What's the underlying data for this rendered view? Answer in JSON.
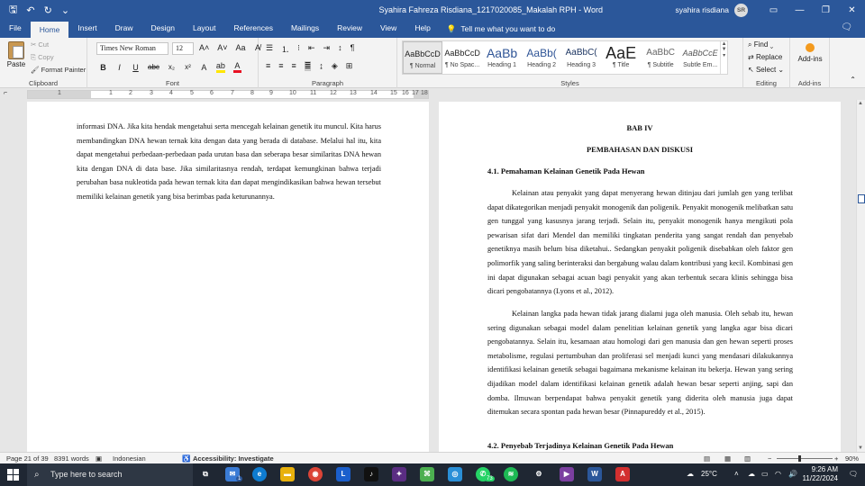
{
  "titlebar": {
    "title": "Syahira Fahreza Risdiana_1217020085_Makalah RPH  -  Word",
    "user_name": "syahira risdiana",
    "user_initials": "SR"
  },
  "tabs": [
    {
      "label": "File"
    },
    {
      "label": "Home"
    },
    {
      "label": "Insert"
    },
    {
      "label": "Draw"
    },
    {
      "label": "Design"
    },
    {
      "label": "Layout"
    },
    {
      "label": "References"
    },
    {
      "label": "Mailings"
    },
    {
      "label": "Review"
    },
    {
      "label": "View"
    },
    {
      "label": "Help"
    }
  ],
  "tellme": "Tell me what you want to do",
  "ribbon": {
    "clipboard": {
      "paste": "Paste",
      "cut": "Cut",
      "copy": "Copy",
      "format_painter": "Format Painter",
      "label": "Clipboard"
    },
    "font": {
      "name": "Times New Roman",
      "size": "12",
      "label": "Font"
    },
    "paragraph": {
      "label": "Paragraph"
    },
    "styles": {
      "label": "Styles",
      "items": [
        {
          "sample": "AaBbCcD",
          "name": "¶ Normal"
        },
        {
          "sample": "AaBbCcD",
          "name": "¶ No Spac..."
        },
        {
          "sample": "AaBb",
          "name": "Heading 1"
        },
        {
          "sample": "AaBb(",
          "name": "Heading 2"
        },
        {
          "sample": "AaBbC(",
          "name": "Heading 3"
        },
        {
          "sample": "AaE",
          "name": "¶ Title"
        },
        {
          "sample": "AaBbC",
          "name": "¶ Subtitle"
        },
        {
          "sample": "AaBbCcE",
          "name": "Subtle Em..."
        }
      ]
    },
    "editing": {
      "find": "Find",
      "replace": "Replace",
      "select": "Select",
      "label": "Editing"
    },
    "addins": {
      "button": "Add-ins",
      "label": "Add-ins"
    }
  },
  "ruler_numbers": [
    "1",
    "1",
    "2",
    "3",
    "4",
    "5",
    "6",
    "7",
    "8",
    "9",
    "10",
    "11",
    "12",
    "13",
    "14",
    "15",
    "16",
    "17",
    "18"
  ],
  "page1": {
    "paragraph": "informasi DNA. Jika kita hendak mengetahui serta mencegah kelainan genetik itu muncul. Kita harus membandingkan DNA hewan ternak kita dengan data yang berada di database. Melalui hal itu, kita dapat mengetahui perbedaan-perbedaan pada urutan basa dan seberapa besar similaritas DNA hewan kita dengan DNA di data base. Jika similaritasnya rendah, terdapat kemungkinan bahwa terjadi perubahan basa nukleotida pada hewan ternak kita dan dapat mengindikasikan bahwa hewan tersebut memiliki kelainan genetik yang bisa berimbas pada keturunannya."
  },
  "page2": {
    "chapter": "BAB IV",
    "chapter_title": "PEMBAHASAN DAN DISKUSI",
    "section1": "4.1. Pemahaman Kelainan Genetik Pada Hewan",
    "para1": "Kelainan atau penyakit yang dapat menyerang hewan ditinjau dari jumlah gen yang terlibat dapat dikategorikan menjadi penyakit monogenik dan poligenik. Penyakit monogenik melibatkan satu gen tunggal yang kasusnya jarang terjadi. Selain itu, penyakit monogenik hanya mengikuti pola pewarisan sifat dari Mendel dan memiliki tingkatan penderita yang sangat rendah dan penyebab genetiknya masih belum bisa diketahui.. Sedangkan penyakit poligenik disebabkan oleh faktor gen polimorfik yang saling berinteraksi dan bergabung walau dalam kontribusi yang kecil. Kombinasi gen ini dapat digunakan sebagai acuan bagi penyakit yang akan terbentuk secara klinis sehingga bisa dicari pengobatannya (Lyons et al., 2012).",
    "para2": "Kelainan langka pada hewan tidak jarang dialami juga oleh manusia. Oleh sebab itu, hewan sering digunakan sebagai model dalam penelitian kelainan genetik yang langka agar bisa dicari pengobatannya. Selain itu, kesamaan atau homologi dari gen manusia dan gen hewan seperti proses metabolisme, regulasi pertumbuhan dan proliferasi sel menjadi kunci yang mendasari dilakukannya identifikasi kelainan genetik sebagai bagaimana mekanisme kelainan itu bekerja. Hewan yang sering dijadikan model dalam identifikasi kelainan genetik adalah hewan besar seperti anjing, sapi dan domba. Ilmuwan berpendapat bahwa penyakit genetik yang diderita oleh manusia juga dapat ditemukan secara spontan pada hewan besar (Pinnapureddy et al., 2015).",
    "section2": "4.2. Penyebab Terjadinya Kelainan Genetik Pada Hewan"
  },
  "status": {
    "page": "Page 21 of 39",
    "words": "8391 words",
    "language": "Indonesian",
    "accessibility": "Accessibility: Investigate",
    "zoom": "90%"
  },
  "taskbar": {
    "search_placeholder": "Type here to search",
    "mail_badge": "1",
    "whatsapp_badge": "73",
    "temperature": "25°C",
    "time": "9:26 AM",
    "date": "11/22/2024"
  }
}
